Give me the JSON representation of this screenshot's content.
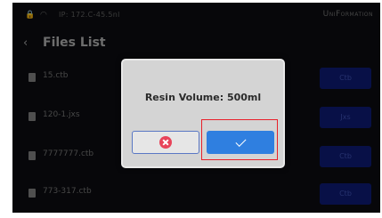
{
  "status_bar": {
    "icons": [
      "lock-icon",
      "wifi-icon"
    ],
    "ip": "IP: 172.C-45.5nl",
    "brand": "UniFormation"
  },
  "header": {
    "back_icon": "chevron-left-icon",
    "title": "Files List"
  },
  "files": [
    {
      "name": "15.ctb",
      "action_label": "Ctb"
    },
    {
      "name": "120-1.jxs",
      "action_label": "Jxs"
    },
    {
      "name": "7777777.ctb",
      "action_label": "Ctb"
    },
    {
      "name": "773-317.ctb",
      "action_label": "Ctb"
    }
  ],
  "dialog": {
    "message": "Resin Volume: 500ml",
    "cancel_icon": "close-circle-icon",
    "confirm_icon": "check-icon"
  },
  "colors": {
    "screen_bg": "#0b0c10",
    "dialog_bg": "#d4d4d4",
    "confirm_blue": "#2f7fe0",
    "cancel_red": "#e8445a",
    "highlight_red": "#e8202a",
    "file_button": "#0d1a6e"
  }
}
